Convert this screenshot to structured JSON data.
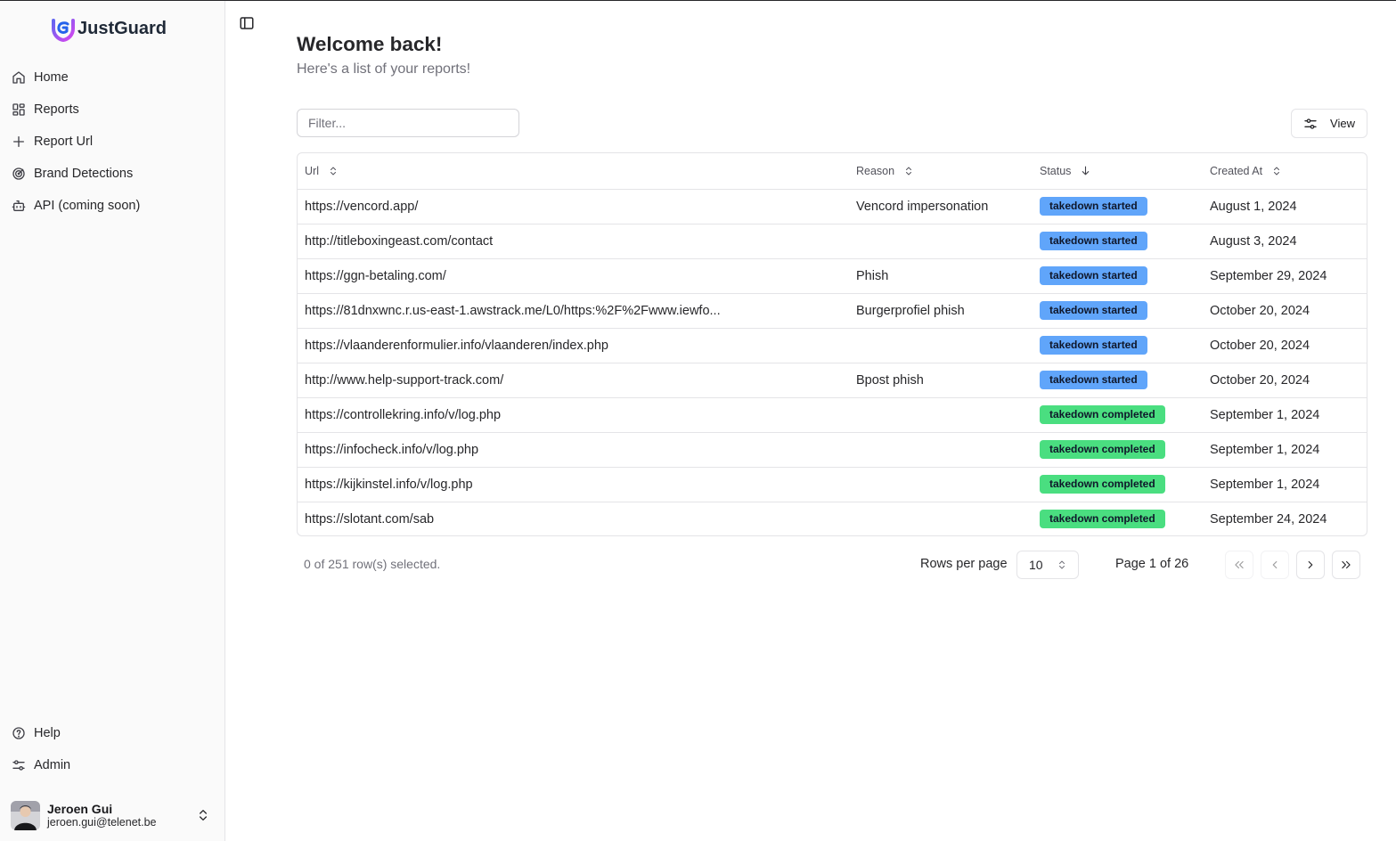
{
  "app": {
    "name": "JustGuard",
    "brand_colors": {
      "logo_from": "#6366f1",
      "logo_to": "#d946ef"
    }
  },
  "sidebar": {
    "items": [
      {
        "label": "Home",
        "icon": "home-icon"
      },
      {
        "label": "Reports",
        "icon": "dashboard-icon"
      },
      {
        "label": "Report Url",
        "icon": "plus-icon"
      },
      {
        "label": "Brand Detections",
        "icon": "radar-icon"
      },
      {
        "label": "API (coming soon)",
        "icon": "bot-icon"
      }
    ],
    "bottom_items": [
      {
        "label": "Help",
        "icon": "help-circle-icon"
      },
      {
        "label": "Admin",
        "icon": "sliders-icon"
      }
    ],
    "user": {
      "name": "Jeroen Gui",
      "email": "jeroen.gui@telenet.be"
    }
  },
  "header": {
    "title": "Welcome back!",
    "subtitle": "Here's a list of your reports!"
  },
  "toolbar": {
    "filter_placeholder": "Filter...",
    "filter_value": "",
    "view_label": "View"
  },
  "table": {
    "columns": [
      {
        "label": "Url",
        "sort": "unsorted"
      },
      {
        "label": "Reason",
        "sort": "unsorted"
      },
      {
        "label": "Status",
        "sort": "descending"
      },
      {
        "label": "Created At",
        "sort": "unsorted"
      }
    ],
    "status_colors": {
      "takedown started": "#60a5fa",
      "takedown completed": "#4ade80"
    },
    "rows": [
      {
        "url": "https://vencord.app/",
        "reason": "Vencord impersonation",
        "status": "takedown started",
        "created_at": "August 1, 2024"
      },
      {
        "url": "http://titleboxingeast.com/contact",
        "reason": "",
        "status": "takedown started",
        "created_at": "August 3, 2024"
      },
      {
        "url": "https://ggn-betaling.com/",
        "reason": "Phish",
        "status": "takedown started",
        "created_at": "September 29, 2024"
      },
      {
        "url": "https://81dnxwnc.r.us-east-1.awstrack.me/L0/https:%2F%2Fwww.iewfo...",
        "reason": "Burgerprofiel phish",
        "status": "takedown started",
        "created_at": "October 20, 2024"
      },
      {
        "url": "https://vlaanderenformulier.info/vlaanderen/index.php",
        "reason": "",
        "status": "takedown started",
        "created_at": "October 20, 2024"
      },
      {
        "url": "http://www.help-support-track.com/",
        "reason": "Bpost phish",
        "status": "takedown started",
        "created_at": "October 20, 2024"
      },
      {
        "url": "https://controllekring.info/v/log.php",
        "reason": "",
        "status": "takedown completed",
        "created_at": "September 1, 2024"
      },
      {
        "url": "https://infocheck.info/v/log.php",
        "reason": "",
        "status": "takedown completed",
        "created_at": "September 1, 2024"
      },
      {
        "url": "https://kijkinstel.info/v/log.php",
        "reason": "",
        "status": "takedown completed",
        "created_at": "September 1, 2024"
      },
      {
        "url": "https://slotant.com/sab",
        "reason": "",
        "status": "takedown completed",
        "created_at": "September 24, 2024"
      }
    ]
  },
  "pagination": {
    "selection_text": "0 of 251 row(s) selected.",
    "rows_per_page_label": "Rows per page",
    "rows_per_page_value": "10",
    "page_text": "Page 1 of 26"
  }
}
